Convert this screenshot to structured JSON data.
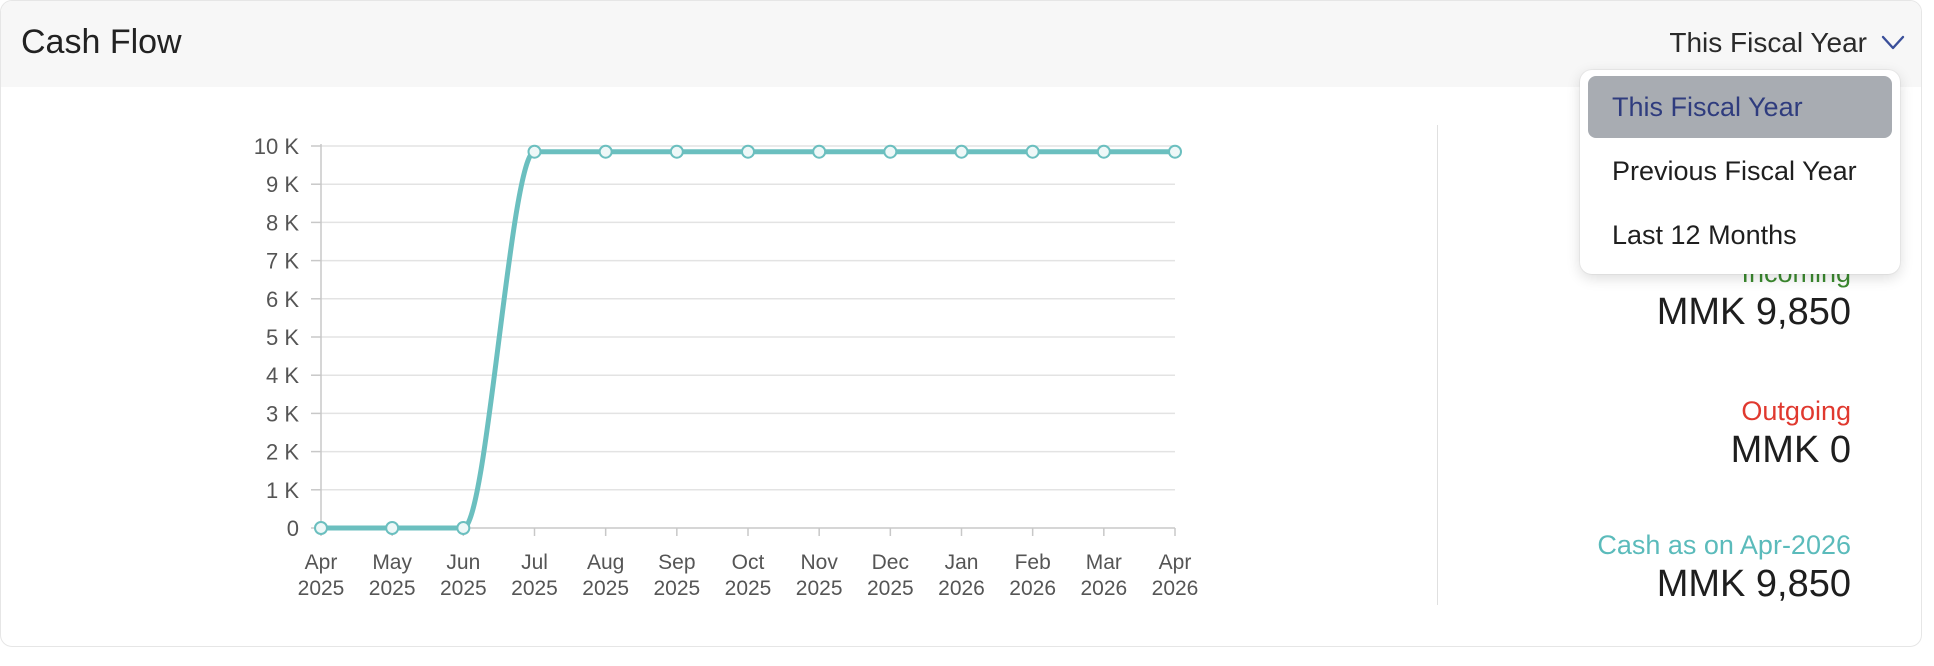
{
  "card": {
    "title": "Cash Flow",
    "period_selector": {
      "value": "This Fiscal Year",
      "icon": "chevron-down-icon"
    }
  },
  "dropdown": {
    "options": [
      "This Fiscal Year",
      "Previous Fiscal Year",
      "Last 12 Months"
    ],
    "selected": "This Fiscal Year"
  },
  "summary": {
    "incoming": {
      "label": "Incoming",
      "value": "MMK 9,850",
      "color": "#3b8a2f"
    },
    "outgoing": {
      "label": "Outgoing",
      "value": "MMK 0",
      "color": "#e0392f"
    },
    "cash": {
      "label": "Cash as on Apr-2026",
      "value": "MMK 9,850",
      "color": "#5bbbbb"
    }
  },
  "chart_data": {
    "type": "line",
    "line_color": "#6bbfbf",
    "x_month": [
      "Apr",
      "May",
      "Jun",
      "Jul",
      "Aug",
      "Sep",
      "Oct",
      "Nov",
      "Dec",
      "Jan",
      "Feb",
      "Mar",
      "Apr"
    ],
    "x_year": [
      "2025",
      "2025",
      "2025",
      "2025",
      "2025",
      "2025",
      "2025",
      "2025",
      "2025",
      "2026",
      "2026",
      "2026",
      "2026"
    ],
    "y_ticks": [
      "0",
      "1 K",
      "2 K",
      "3 K",
      "4 K",
      "5 K",
      "6 K",
      "7 K",
      "8 K",
      "9 K",
      "10 K"
    ],
    "ylim": [
      0,
      10000
    ],
    "grid": true,
    "series": [
      {
        "values": [
          0,
          0,
          0,
          9850,
          9850,
          9850,
          9850,
          9850,
          9850,
          9850,
          9850,
          9850,
          9850
        ]
      }
    ]
  }
}
